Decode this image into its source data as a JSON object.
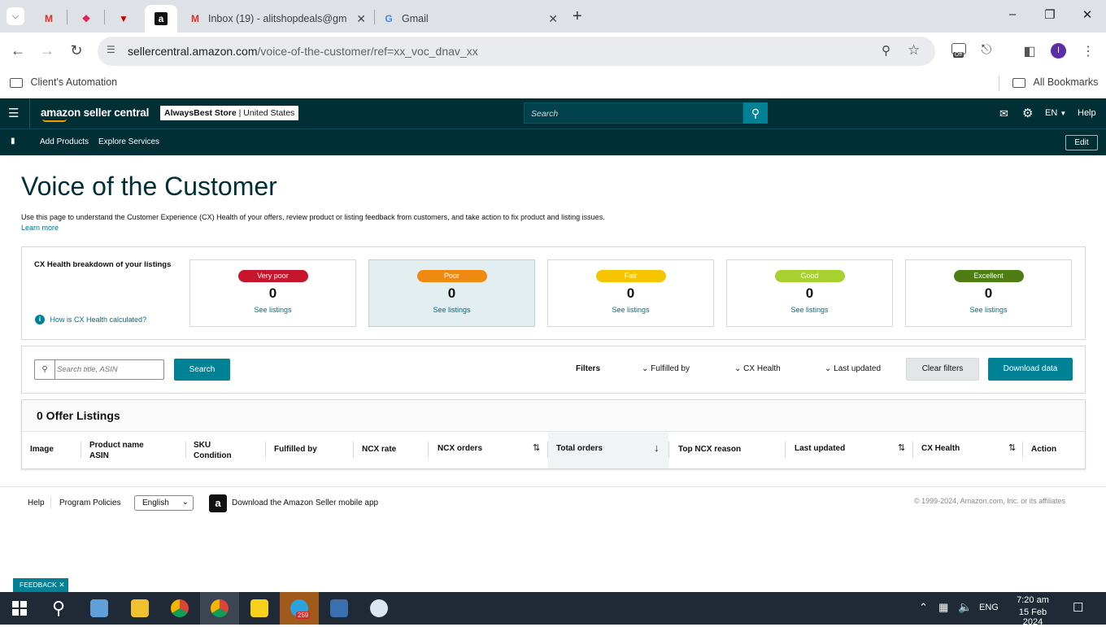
{
  "browser": {
    "tabs": [
      {
        "title": "",
        "favicon": "gmail-icon"
      },
      {
        "title": "",
        "favicon": "slack-icon"
      },
      {
        "title": "",
        "favicon": "vpn-icon"
      },
      {
        "title": "",
        "favicon": "amazon-icon",
        "active": true
      },
      {
        "title": "Inbox (19) - alitshopdeals@gma",
        "favicon": "gmail-icon"
      },
      {
        "title": "Gmail",
        "favicon": "google-icon"
      }
    ],
    "url_domain": "sellercentral.amazon.com",
    "url_path": "/voice-of-the-customer/ref=xx_voc_dnav_xx",
    "profile_initial": "I",
    "ext_badge": "Off",
    "bookmarks": {
      "folder": "Client's Automation",
      "all": "All Bookmarks"
    }
  },
  "header": {
    "logo": "amazon seller central",
    "store_name": "AlwaysBest Store",
    "store_region": "United States",
    "search_placeholder": "Search",
    "lang": "EN",
    "help": "Help",
    "nav": [
      "Add Products",
      "Explore Services"
    ],
    "edit": "Edit"
  },
  "page": {
    "title": "Voice of the Customer",
    "description": "Use this page to understand the Customer Experience (CX) Health of your offers, review product or listing feedback from customers, and take action to fix product and listing issues.",
    "learn_more": "Learn more"
  },
  "health": {
    "label": "CX Health breakdown of your listings",
    "how_link": "How is CX Health calculated?",
    "cards": [
      {
        "label": "Very poor",
        "value": "0",
        "link": "See listings",
        "color": "#c7162b"
      },
      {
        "label": "Poor",
        "value": "0",
        "link": "See listings",
        "color": "#f0890f"
      },
      {
        "label": "Fair",
        "value": "0",
        "link": "See listings",
        "color": "#f7c400"
      },
      {
        "label": "Good",
        "value": "0",
        "link": "See listings",
        "color": "#a6d12e"
      },
      {
        "label": "Excellent",
        "value": "0",
        "link": "See listings",
        "color": "#4e7d14"
      }
    ]
  },
  "search": {
    "placeholder": "Search title, ASIN",
    "button": "Search",
    "filters_label": "Filters",
    "filters": [
      "Fulfilled by",
      "CX Health",
      "Last updated"
    ],
    "clear": "Clear filters",
    "download": "Download data"
  },
  "listings": {
    "title": "0 Offer Listings",
    "columns": [
      {
        "line1": "Image",
        "line2": ""
      },
      {
        "line1": "Product name",
        "line2": "ASIN"
      },
      {
        "line1": "SKU",
        "line2": "Condition"
      },
      {
        "line1": "Fulfilled by",
        "line2": ""
      },
      {
        "line1": "NCX rate",
        "line2": ""
      },
      {
        "line1": "NCX orders",
        "line2": ""
      },
      {
        "line1": "Total orders",
        "line2": ""
      },
      {
        "line1": "Top NCX reason",
        "line2": ""
      },
      {
        "line1": "Last updated",
        "line2": ""
      },
      {
        "line1": "CX Health",
        "line2": ""
      },
      {
        "line1": "Action",
        "line2": ""
      }
    ]
  },
  "footer": {
    "help": "Help",
    "policies": "Program Policies",
    "language": "English",
    "app": "Download the Amazon Seller mobile app",
    "copyright": "© 1999-2024, Amazon.com, Inc. or its affiliates"
  },
  "feedback": "FEEDBACK",
  "taskbar": {
    "lang": "ENG",
    "time": "7:20 am",
    "date": "15 Feb 2024",
    "telegram_badge": "259"
  }
}
